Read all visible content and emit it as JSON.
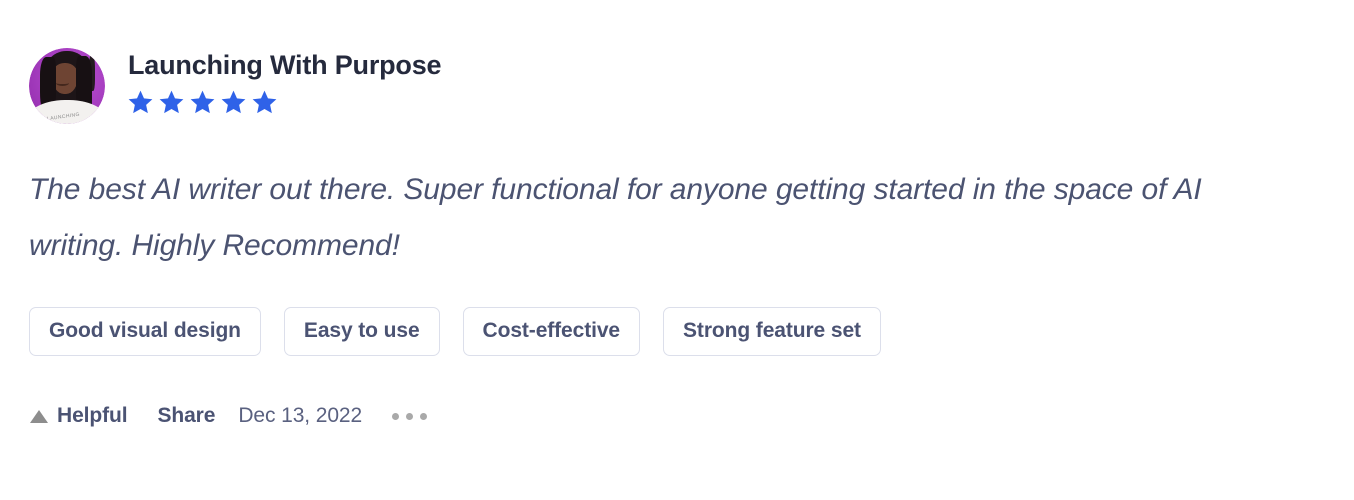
{
  "review": {
    "reviewer_name": "Launching With Purpose",
    "avatar": {
      "icon": "user-avatar-photo",
      "alt": "Launching With Purpose profile photo",
      "shirt_text": "LAUNCHING",
      "background_color": "#a43cbe"
    },
    "rating": {
      "value": 5,
      "max": 5,
      "star_icon": "star-filled-icon",
      "star_color": "#2f62e8"
    },
    "text_lines": [
      "The best AI writer out there. Super functional for anyone getting started in the",
      "space of AI writing. Highly Recommend!"
    ],
    "text_full": "The best AI writer out there. Super functional for anyone getting started in the space of AI writing. Highly Recommend!",
    "tags": [
      "Good visual design",
      "Easy to use",
      "Cost-effective",
      "Strong feature set"
    ],
    "footer": {
      "helpful_label": "Helpful",
      "helpful_icon": "triangle-up-icon",
      "share_label": "Share",
      "date": "Dec 13, 2022",
      "more_icon": "ellipsis-horizontal-icon"
    }
  },
  "colors": {
    "name_text": "#252a3d",
    "body_text": "#4b5371",
    "tag_text": "#4b5373",
    "tag_border": "#dcdfeb",
    "star": "#2f62e8",
    "date_text": "#5a6180",
    "muted_icon": "#a9a9a9",
    "background": "#ffffff"
  }
}
